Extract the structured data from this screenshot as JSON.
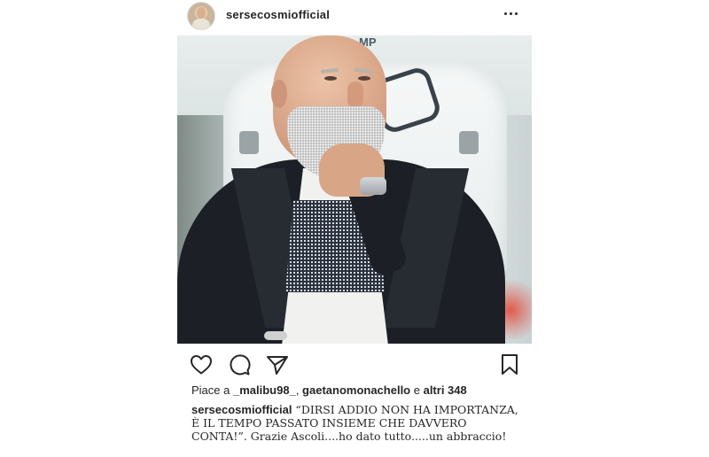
{
  "header": {
    "username": "sersecosmiofficial",
    "avatar_icon": "profile-avatar",
    "more_icon": "more-horizontal-icon"
  },
  "photo": {
    "sign_text": "MP"
  },
  "actions": {
    "like_icon": "heart-icon",
    "comment_icon": "comment-icon",
    "share_icon": "paper-plane-icon",
    "save_icon": "bookmark-icon"
  },
  "likes": {
    "prefix": "Piace a ",
    "user1": "_malibu98_",
    "separator": ", ",
    "user2": "gaetanomonachello",
    "connector": " e ",
    "others": "altri 348"
  },
  "caption": {
    "username": "sersecosmiofficial",
    "text": " “DIRSI ADDIO NON HA IMPORTANZA, È IL TEMPO PASSATO INSIEME CHE DAVVERO CONTA!”. Grazie Ascoli....ho dato tutto.....un abbraccio!"
  },
  "colors": {
    "text": "#262626",
    "background": "#ffffff"
  }
}
